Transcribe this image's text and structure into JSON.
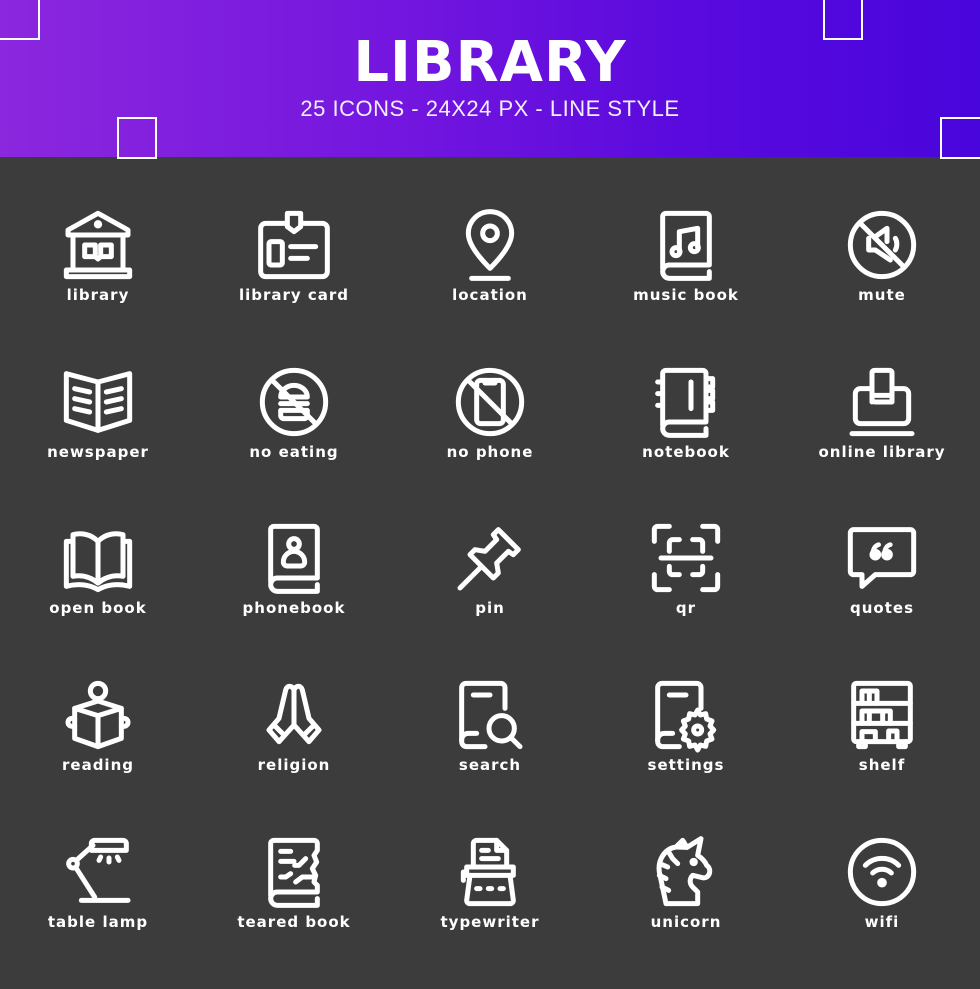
{
  "header": {
    "title": "LIBRARY",
    "subtitle": "25 ICONS - 24X24 PX - LINE STYLE",
    "gradient_start": "#8b27dd",
    "gradient_end": "#4805dc"
  },
  "colors": {
    "background": "#3c3c3c",
    "icon_stroke": "#ffffff",
    "label_text": "#ffffff"
  },
  "icons": [
    {
      "label": "library",
      "icon": "library-building-icon"
    },
    {
      "label": "library card",
      "icon": "id-card-icon"
    },
    {
      "label": "location",
      "icon": "map-pin-icon"
    },
    {
      "label": "music book",
      "icon": "music-book-icon"
    },
    {
      "label": "mute",
      "icon": "speaker-muted-icon"
    },
    {
      "label": "newspaper",
      "icon": "newspaper-icon"
    },
    {
      "label": "no eating",
      "icon": "no-burger-icon"
    },
    {
      "label": "no phone",
      "icon": "no-phone-icon"
    },
    {
      "label": "notebook",
      "icon": "notebook-icon"
    },
    {
      "label": "online library",
      "icon": "laptop-book-icon"
    },
    {
      "label": "open book",
      "icon": "open-book-icon"
    },
    {
      "label": "phonebook",
      "icon": "contact-book-icon"
    },
    {
      "label": "pin",
      "icon": "push-pin-icon"
    },
    {
      "label": "qr",
      "icon": "qr-scan-icon"
    },
    {
      "label": "quotes",
      "icon": "quote-bubble-icon"
    },
    {
      "label": "reading",
      "icon": "person-reading-icon"
    },
    {
      "label": "religion",
      "icon": "praying-hands-icon"
    },
    {
      "label": "search",
      "icon": "book-search-icon"
    },
    {
      "label": "settings",
      "icon": "book-gear-icon"
    },
    {
      "label": "shelf",
      "icon": "bookshelf-icon"
    },
    {
      "label": "table lamp",
      "icon": "desk-lamp-icon"
    },
    {
      "label": "teared book",
      "icon": "torn-book-icon"
    },
    {
      "label": "typewriter",
      "icon": "typewriter-icon"
    },
    {
      "label": "unicorn",
      "icon": "unicorn-icon"
    },
    {
      "label": "wifi",
      "icon": "wifi-circle-icon"
    }
  ]
}
